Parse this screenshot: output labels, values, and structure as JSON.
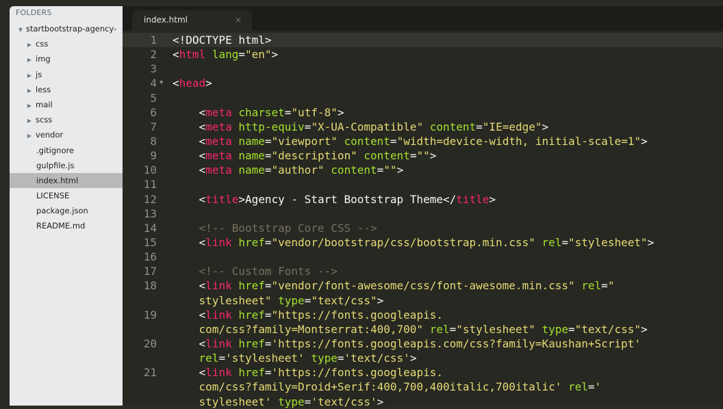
{
  "sidebar": {
    "header": "FOLDERS",
    "items": [
      {
        "label": "startbootstrap-agency-",
        "kind": "root",
        "arrow": "▼"
      },
      {
        "label": "css",
        "kind": "folder",
        "arrow": "▶"
      },
      {
        "label": "img",
        "kind": "folder",
        "arrow": "▶"
      },
      {
        "label": "js",
        "kind": "folder",
        "arrow": "▶"
      },
      {
        "label": "less",
        "kind": "folder",
        "arrow": "▶"
      },
      {
        "label": "mail",
        "kind": "folder",
        "arrow": "▶"
      },
      {
        "label": "scss",
        "kind": "folder",
        "arrow": "▶"
      },
      {
        "label": "vendor",
        "kind": "folder",
        "arrow": "▶"
      },
      {
        "label": ".gitignore",
        "kind": "file"
      },
      {
        "label": "gulpfile.js",
        "kind": "file"
      },
      {
        "label": "index.html",
        "kind": "file",
        "selected": true
      },
      {
        "label": "LICENSE",
        "kind": "file"
      },
      {
        "label": "package.json",
        "kind": "file"
      },
      {
        "label": "README.md",
        "kind": "file"
      }
    ]
  },
  "tab": {
    "label": "index.html",
    "close": "×"
  },
  "editor": {
    "current_line": 1,
    "lines": [
      {
        "num": "1",
        "tokens": [
          [
            "p",
            "<!DOCTYPE html>"
          ]
        ]
      },
      {
        "num": "2",
        "tokens": [
          [
            "p",
            "<"
          ],
          [
            "t",
            "html"
          ],
          [
            "p",
            " "
          ],
          [
            "a",
            "lang"
          ],
          [
            "p",
            "="
          ],
          [
            "s",
            "\"en\""
          ],
          [
            "p",
            ">"
          ]
        ]
      },
      {
        "num": "3",
        "tokens": []
      },
      {
        "num": "4",
        "fold": "▼",
        "tokens": [
          [
            "p",
            "<"
          ],
          [
            "t",
            "head"
          ],
          [
            "p",
            ">"
          ]
        ]
      },
      {
        "num": "5",
        "tokens": []
      },
      {
        "num": "6",
        "tokens": [
          [
            "p",
            "    <"
          ],
          [
            "t",
            "meta"
          ],
          [
            "p",
            " "
          ],
          [
            "a",
            "charset"
          ],
          [
            "p",
            "="
          ],
          [
            "s",
            "\"utf-8\""
          ],
          [
            "p",
            ">"
          ]
        ]
      },
      {
        "num": "7",
        "tokens": [
          [
            "p",
            "    <"
          ],
          [
            "t",
            "meta"
          ],
          [
            "p",
            " "
          ],
          [
            "a",
            "http-equiv"
          ],
          [
            "p",
            "="
          ],
          [
            "s",
            "\"X-UA-Compatible\""
          ],
          [
            "p",
            " "
          ],
          [
            "a",
            "content"
          ],
          [
            "p",
            "="
          ],
          [
            "s",
            "\"IE=edge\""
          ],
          [
            "p",
            ">"
          ]
        ]
      },
      {
        "num": "8",
        "tokens": [
          [
            "p",
            "    <"
          ],
          [
            "t",
            "meta"
          ],
          [
            "p",
            " "
          ],
          [
            "a",
            "name"
          ],
          [
            "p",
            "="
          ],
          [
            "s",
            "\"viewport\""
          ],
          [
            "p",
            " "
          ],
          [
            "a",
            "content"
          ],
          [
            "p",
            "="
          ],
          [
            "s",
            "\"width=device-width, initial-scale=1\""
          ],
          [
            "p",
            ">"
          ]
        ]
      },
      {
        "num": "9",
        "tokens": [
          [
            "p",
            "    <"
          ],
          [
            "t",
            "meta"
          ],
          [
            "p",
            " "
          ],
          [
            "a",
            "name"
          ],
          [
            "p",
            "="
          ],
          [
            "s",
            "\"description\""
          ],
          [
            "p",
            " "
          ],
          [
            "a",
            "content"
          ],
          [
            "p",
            "="
          ],
          [
            "s",
            "\"\""
          ],
          [
            "p",
            ">"
          ]
        ]
      },
      {
        "num": "10",
        "tokens": [
          [
            "p",
            "    <"
          ],
          [
            "t",
            "meta"
          ],
          [
            "p",
            " "
          ],
          [
            "a",
            "name"
          ],
          [
            "p",
            "="
          ],
          [
            "s",
            "\"author\""
          ],
          [
            "p",
            " "
          ],
          [
            "a",
            "content"
          ],
          [
            "p",
            "="
          ],
          [
            "s",
            "\"\""
          ],
          [
            "p",
            ">"
          ]
        ]
      },
      {
        "num": "11",
        "tokens": []
      },
      {
        "num": "12",
        "tokens": [
          [
            "p",
            "    <"
          ],
          [
            "t",
            "title"
          ],
          [
            "p",
            ">Agency - Start Bootstrap Theme</"
          ],
          [
            "t",
            "title"
          ],
          [
            "p",
            ">"
          ]
        ]
      },
      {
        "num": "13",
        "tokens": []
      },
      {
        "num": "14",
        "tokens": [
          [
            "p",
            "    "
          ],
          [
            "c",
            "<!-- Bootstrap Core CSS -->"
          ]
        ]
      },
      {
        "num": "15",
        "tokens": [
          [
            "p",
            "    <"
          ],
          [
            "t",
            "link"
          ],
          [
            "p",
            " "
          ],
          [
            "a",
            "href"
          ],
          [
            "p",
            "="
          ],
          [
            "s",
            "\"vendor/bootstrap/css/bootstrap.min.css\""
          ],
          [
            "p",
            " "
          ],
          [
            "a",
            "rel"
          ],
          [
            "p",
            "="
          ],
          [
            "s",
            "\"stylesheet\""
          ],
          [
            "p",
            ">"
          ]
        ]
      },
      {
        "num": "16",
        "tokens": []
      },
      {
        "num": "17",
        "tokens": [
          [
            "p",
            "    "
          ],
          [
            "c",
            "<!-- Custom Fonts -->"
          ]
        ]
      },
      {
        "num": "18",
        "tokens": [
          [
            "p",
            "    <"
          ],
          [
            "t",
            "link"
          ],
          [
            "p",
            " "
          ],
          [
            "a",
            "href"
          ],
          [
            "p",
            "="
          ],
          [
            "s",
            "\"vendor/font-awesome/css/font-awesome.min.css\""
          ],
          [
            "p",
            " "
          ],
          [
            "a",
            "rel"
          ],
          [
            "p",
            "="
          ],
          [
            "s",
            "\""
          ]
        ]
      },
      {
        "num": "",
        "tokens": [
          [
            "s",
            "    stylesheet\""
          ],
          [
            "p",
            " "
          ],
          [
            "a",
            "type"
          ],
          [
            "p",
            "="
          ],
          [
            "s",
            "\"text/css\""
          ],
          [
            "p",
            ">"
          ]
        ]
      },
      {
        "num": "19",
        "tokens": [
          [
            "p",
            "    <"
          ],
          [
            "t",
            "link"
          ],
          [
            "p",
            " "
          ],
          [
            "a",
            "href"
          ],
          [
            "p",
            "="
          ],
          [
            "s",
            "\"https://fonts.googleapis."
          ]
        ]
      },
      {
        "num": "",
        "tokens": [
          [
            "s",
            "    com/css?family=Montserrat:400,700\""
          ],
          [
            "p",
            " "
          ],
          [
            "a",
            "rel"
          ],
          [
            "p",
            "="
          ],
          [
            "s",
            "\"stylesheet\""
          ],
          [
            "p",
            " "
          ],
          [
            "a",
            "type"
          ],
          [
            "p",
            "="
          ],
          [
            "s",
            "\"text/css\""
          ],
          [
            "p",
            ">"
          ]
        ]
      },
      {
        "num": "20",
        "tokens": [
          [
            "p",
            "    <"
          ],
          [
            "t",
            "link"
          ],
          [
            "p",
            " "
          ],
          [
            "a",
            "href"
          ],
          [
            "p",
            "="
          ],
          [
            "s",
            "'https://fonts.googleapis.com/css?family=Kaushan+Script'"
          ]
        ]
      },
      {
        "num": "",
        "tokens": [
          [
            "p",
            "    "
          ],
          [
            "a",
            "rel"
          ],
          [
            "p",
            "="
          ],
          [
            "s",
            "'stylesheet'"
          ],
          [
            "p",
            " "
          ],
          [
            "a",
            "type"
          ],
          [
            "p",
            "="
          ],
          [
            "s",
            "'text/css'"
          ],
          [
            "p",
            ">"
          ]
        ]
      },
      {
        "num": "21",
        "tokens": [
          [
            "p",
            "    <"
          ],
          [
            "t",
            "link"
          ],
          [
            "p",
            " "
          ],
          [
            "a",
            "href"
          ],
          [
            "p",
            "="
          ],
          [
            "s",
            "'https://fonts.googleapis."
          ]
        ]
      },
      {
        "num": "",
        "tokens": [
          [
            "s",
            "    com/css?family=Droid+Serif:400,700,400italic,700italic'"
          ],
          [
            "p",
            " "
          ],
          [
            "a",
            "rel"
          ],
          [
            "p",
            "="
          ],
          [
            "s",
            "'"
          ]
        ]
      },
      {
        "num": "",
        "tokens": [
          [
            "s",
            "    stylesheet'"
          ],
          [
            "p",
            " "
          ],
          [
            "a",
            "type"
          ],
          [
            "p",
            "="
          ],
          [
            "s",
            "'text/css'"
          ],
          [
            "p",
            ">"
          ]
        ]
      }
    ]
  }
}
